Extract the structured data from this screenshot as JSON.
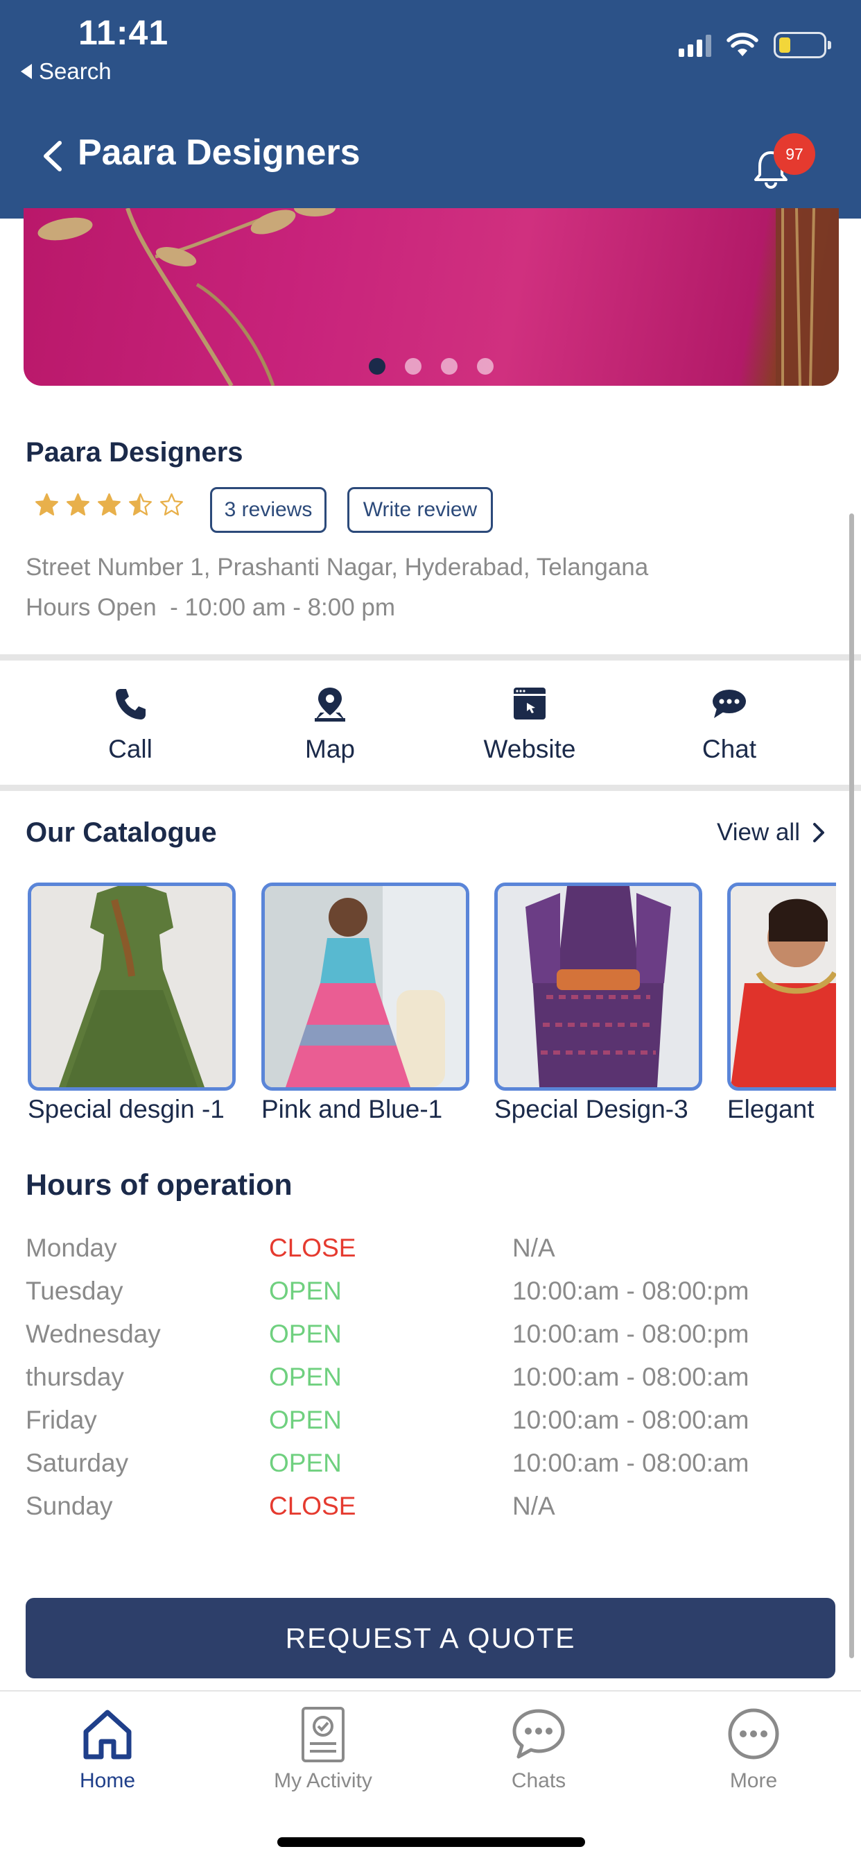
{
  "status_bar": {
    "time": "11:41",
    "back_label": "Search"
  },
  "header": {
    "title": "Paara Designers",
    "notification_count": "97"
  },
  "carousel": {
    "pages": 4,
    "active_index": 0
  },
  "business": {
    "name": "Paara Designers",
    "rating": 3.5,
    "rating_max": 5,
    "reviews_label": "3 reviews",
    "write_review_label": "Write review",
    "address": "Street Number 1, Prashanti Nagar, Hyderabad, Telangana",
    "hours_open": "Hours Open  - 10:00 am - 8:00 pm"
  },
  "actions": [
    {
      "label": "Call",
      "icon": "phone-icon"
    },
    {
      "label": "Map",
      "icon": "map-pin-icon"
    },
    {
      "label": "Website",
      "icon": "website-icon"
    },
    {
      "label": "Chat",
      "icon": "chat-icon"
    }
  ],
  "catalogue": {
    "title": "Our Catalogue",
    "view_all_label": "View all",
    "items": [
      {
        "label": "Special desgin -1"
      },
      {
        "label": "Pink and Blue-1"
      },
      {
        "label": "Special Design-3"
      },
      {
        "label": "Elegant"
      }
    ]
  },
  "hours": {
    "title": "Hours of operation",
    "rows": [
      {
        "day": "Monday",
        "status": "CLOSE",
        "time": "N/A"
      },
      {
        "day": "Tuesday",
        "status": "OPEN",
        "time": "10:00:am - 08:00:pm"
      },
      {
        "day": "Wednesday",
        "status": "OPEN",
        "time": "10:00:am - 08:00:pm"
      },
      {
        "day": "thursday",
        "status": "OPEN",
        "time": "10:00:am - 08:00:am"
      },
      {
        "day": "Friday",
        "status": "OPEN",
        "time": "10:00:am - 08:00:am"
      },
      {
        "day": "Saturday",
        "status": "OPEN",
        "time": "10:00:am - 08:00:am"
      },
      {
        "day": "Sunday",
        "status": "CLOSE",
        "time": "N/A"
      }
    ]
  },
  "cta": {
    "label": "REQUEST A QUOTE"
  },
  "tabbar": [
    {
      "label": "Home",
      "icon": "home-icon",
      "active": true
    },
    {
      "label": "My Activity",
      "icon": "activity-icon",
      "active": false
    },
    {
      "label": "Chats",
      "icon": "chat-bubble-icon",
      "active": false
    },
    {
      "label": "More",
      "icon": "more-icon",
      "active": false
    }
  ],
  "colors": {
    "header_bg": "#2c5288",
    "primary_text": "#1b2a4a",
    "open": "#6fd07f",
    "closed": "#e53a2f",
    "cta_bg": "#2d3f6a",
    "star": "#e8b04b",
    "badge": "#e53a2f"
  }
}
